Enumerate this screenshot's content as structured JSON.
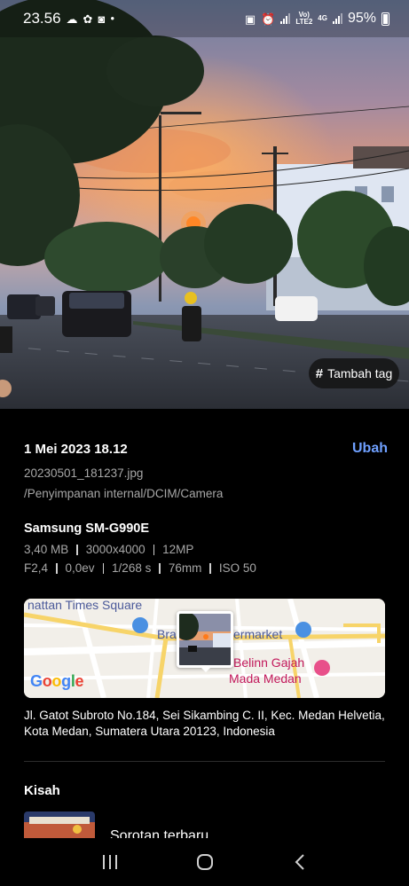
{
  "status_bar": {
    "time": "23.56",
    "left_icons": [
      "cloud-icon",
      "game-launcher-icon",
      "instagram-icon"
    ],
    "right_icons": [
      "screenshot-icon",
      "alarm-icon"
    ],
    "network_label_top": "Vo)",
    "network_label_bottom": "LTE2",
    "network_type": "4G",
    "battery_percent": "95%"
  },
  "photo": {
    "tag_button_icon": "#",
    "tag_button_label": "Tambah tag"
  },
  "details": {
    "date": "1 Mei 2023 18.12",
    "edit_label": "Ubah",
    "filename": "20230501_181237.jpg",
    "path": "/Penyimpanan internal/DCIM/Camera",
    "device": "Samsung SM-G990E",
    "size": "3,40 MB",
    "resolution": "3000x4000",
    "megapixels": "12MP",
    "aperture": "F2,4",
    "exposure": "0,0ev",
    "shutter": "1/268 s",
    "focal_length": "76mm",
    "iso": "ISO 50"
  },
  "map": {
    "label_top": "nattan Times Square",
    "label_mid_left": "Bra",
    "label_mid_right": "ermarket",
    "label_place_line1": "Belinn Gajah",
    "label_place_line2": "Mada Medan",
    "google_letters": [
      "G",
      "o",
      "o",
      "g",
      "l",
      "e"
    ],
    "google_colors": [
      "#4285F4",
      "#EA4335",
      "#FBBC05",
      "#4285F4",
      "#34A853",
      "#EA4335"
    ]
  },
  "address": "Jl. Gatot Subroto No.184, Sei Sikambing C. II, Kec. Medan Helvetia, Kota Medan, Sumatera Utara 20123, Indonesia",
  "stories": {
    "title": "Kisah",
    "item_label": "Sorotan terbaru"
  },
  "navbar": {
    "icons": [
      "recent-apps-icon",
      "home-icon",
      "back-icon"
    ]
  },
  "colors": {
    "accent": "#6fa0ff",
    "secondary_text": "#a7a7a7",
    "background": "#000000"
  }
}
